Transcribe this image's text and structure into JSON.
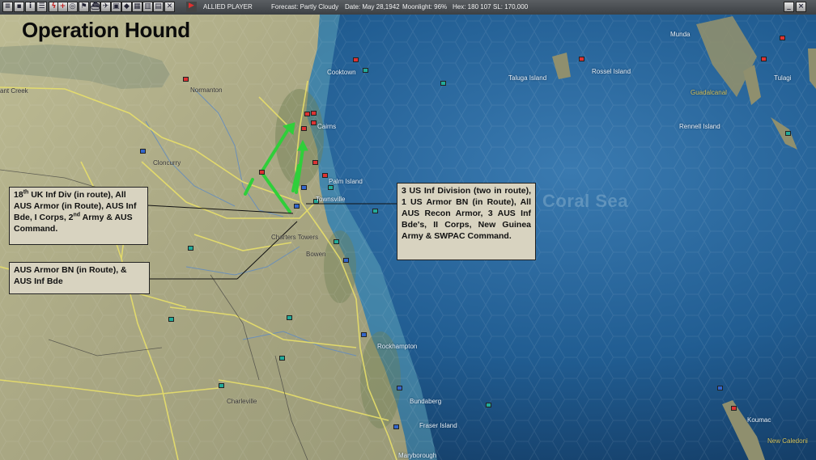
{
  "toolbar": {
    "player": "ALLIED PLAYER",
    "forecast": "Forecast: Partly Cloudy",
    "date": "Date: May 28,1942",
    "moonlight": "Moonlight: 96%",
    "hex": "Hex: 180 107",
    "sl": "SL: 170,000",
    "buttons": [
      "menu-icon",
      "save-icon",
      "info-icon",
      "list-icon",
      "lightning-icon",
      "cross-icon",
      "target-icon",
      "flag-icon",
      "ship-icon",
      "plane-icon",
      "base-icon",
      "unit-icon",
      "table-icon",
      "chart-icon",
      "document-icon",
      "close-icon",
      "end-turn-icon"
    ],
    "window_buttons": [
      "minimize-icon",
      "close-icon"
    ]
  },
  "map": {
    "title": "Operation Hound",
    "sea_name": "Coral Sea",
    "places": {
      "munda": "Munda",
      "tulagi": "Tulagi",
      "cooktown": "Cooktown",
      "taluga": "Taluga Island",
      "rossel": "Rossel Island",
      "guadalcanal": "Guadalcanal",
      "normanton": "Normanton",
      "cairns": "Cairns",
      "rennell": "Rennell Island",
      "ant_creek": "ant Creek",
      "cloncurry": "Cloncurry",
      "palm": "Palm Island",
      "townsville": "Townsville",
      "charters": "Charters Towers",
      "bowen": "Bowen",
      "rockhampton": "Rockhampton",
      "bundaberg": "Bundaberg",
      "fraser": "Fraser Island",
      "maryborough": "Maryborough",
      "charleville": "Charleville",
      "koumac": "Koumac",
      "new_caledonia": "New Caledoni"
    }
  },
  "callouts": {
    "northwest": {
      "l1_num": "18",
      "l1_sup": "th",
      "l1_rest": " UK Inf Div (in route), All AUS Armor (in Route), AUS Inf Bde, I Corps, 2",
      "l2_sup": "nd",
      "l2_rest": " Army & AUS Command."
    },
    "southwest": "AUS Armor BN (in Route), & AUS Inf Bde",
    "east": "3 US Inf Division (two in route), 1 US Armor BN (in Route), All AUS Recon Armor, 3 AUS Inf Bde's, II Corps, New Guinea Army & SWPAC Command."
  },
  "colors": {
    "ocean": "#1f5b8e",
    "land": "#b7b48c",
    "roads": "#e8df6a",
    "arrows": "#2fcf3a",
    "callout_bg": "#d8d3c0"
  }
}
